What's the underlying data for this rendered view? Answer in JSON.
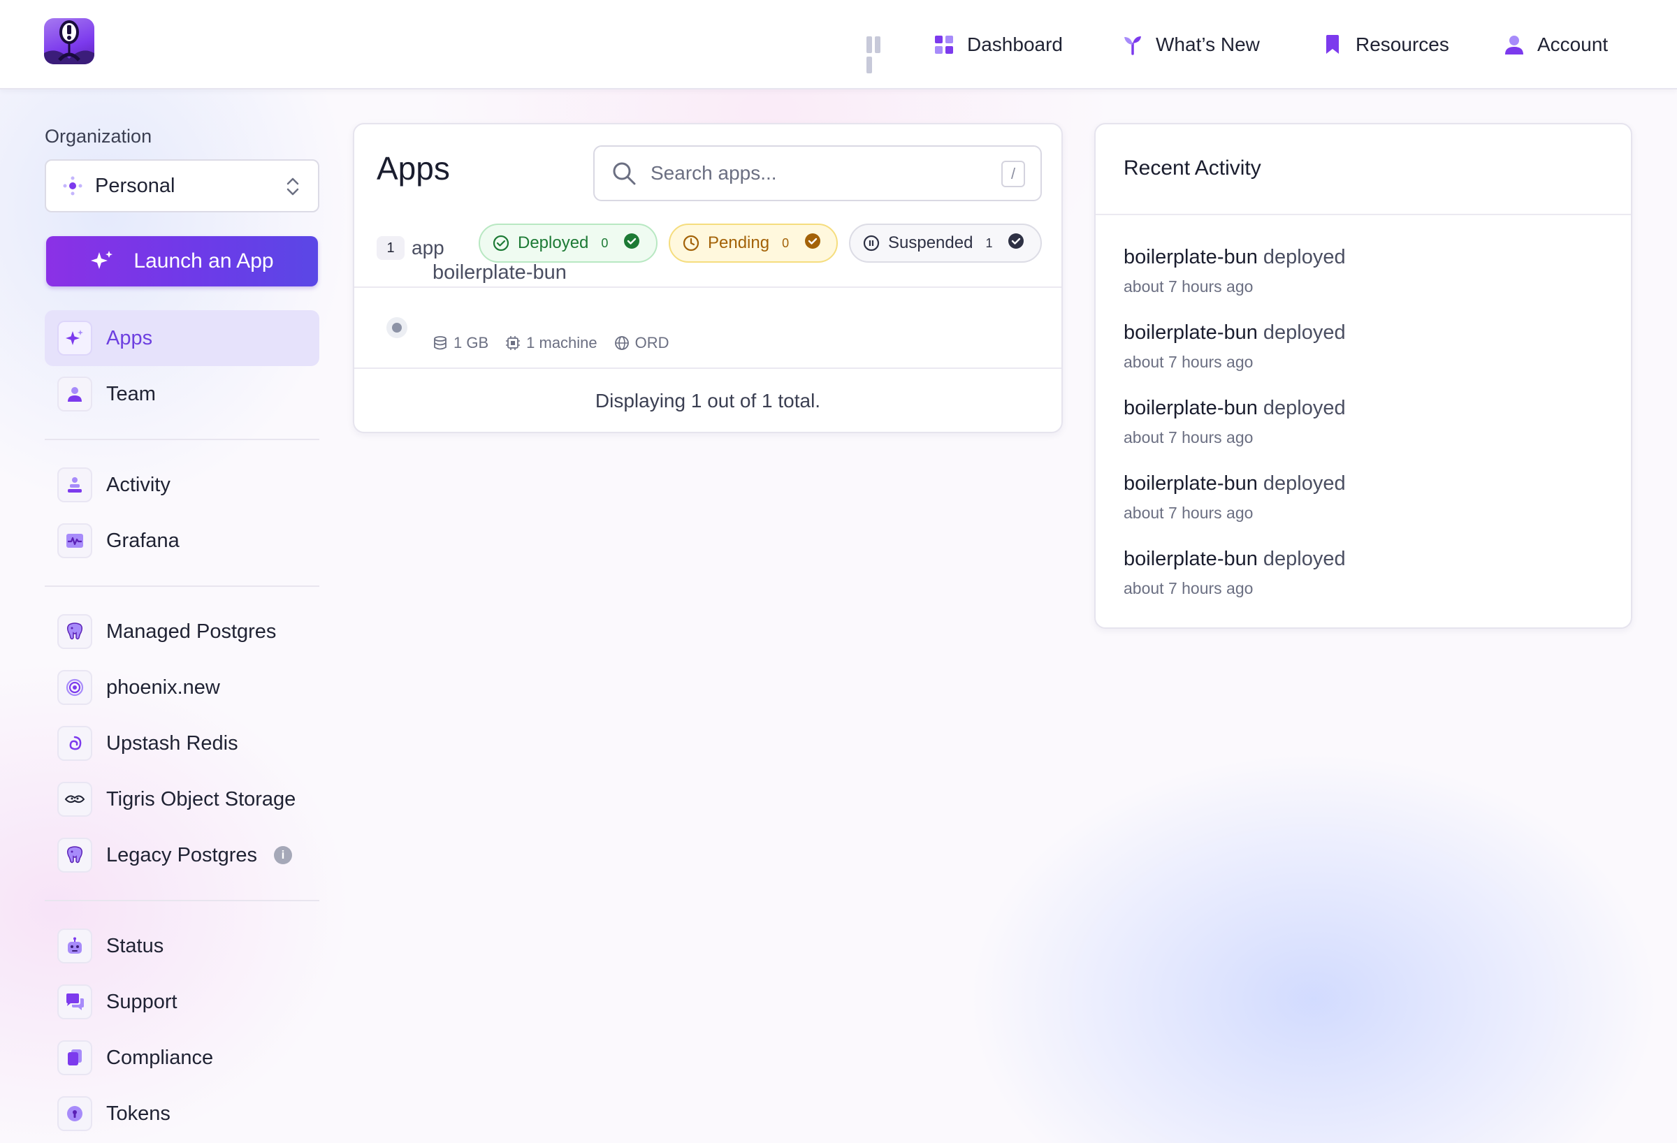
{
  "nav": {
    "dashboard": "Dashboard",
    "whats_new": "What’s New",
    "resources": "Resources",
    "account": "Account"
  },
  "sidebar": {
    "org_label": "Organization",
    "org_value": "Personal",
    "launch_label": "Launch an App",
    "groups": [
      [
        "Apps",
        "Team"
      ],
      [
        "Activity",
        "Grafana"
      ],
      [
        "Managed Postgres",
        "phoenix.new",
        "Upstash Redis",
        "Tigris Object Storage",
        "Legacy Postgres"
      ],
      [
        "Status",
        "Support",
        "Compliance",
        "Tokens"
      ]
    ],
    "items": {
      "apps": "Apps",
      "team": "Team",
      "activity": "Activity",
      "grafana": "Grafana",
      "managed_postgres": "Managed Postgres",
      "phoenix": "phoenix.new",
      "upstash": "Upstash Redis",
      "tigris": "Tigris Object Storage",
      "legacy_postgres": "Legacy Postgres",
      "status": "Status",
      "support": "Support",
      "compliance": "Compliance",
      "tokens": "Tokens"
    },
    "active": "Apps"
  },
  "apps": {
    "title": "Apps",
    "search_placeholder": "Search apps...",
    "search_shortcut": "/",
    "count": "1",
    "count_label": "app",
    "filters": {
      "deployed": {
        "label": "Deployed",
        "count": "0"
      },
      "pending": {
        "label": "Pending",
        "count": "0"
      },
      "suspended": {
        "label": "Suspended",
        "count": "1"
      }
    },
    "rows": [
      {
        "name": "boilerplate-bun",
        "memory": "1 GB",
        "machines": "1 machine",
        "region": "ORD"
      }
    ],
    "footer": "Displaying 1 out of 1 total."
  },
  "activity": {
    "title": "Recent Activity",
    "items": [
      {
        "app": "boilerplate-bun",
        "verb": "deployed",
        "time": "about 7 hours ago"
      },
      {
        "app": "boilerplate-bun",
        "verb": "deployed",
        "time": "about 7 hours ago"
      },
      {
        "app": "boilerplate-bun",
        "verb": "deployed",
        "time": "about 7 hours ago"
      },
      {
        "app": "boilerplate-bun",
        "verb": "deployed",
        "time": "about 7 hours ago"
      },
      {
        "app": "boilerplate-bun",
        "verb": "deployed",
        "time": "about 7 hours ago"
      }
    ]
  },
  "colors": {
    "accent": "#7c3aed",
    "deployed": "#1d7a35",
    "pending": "#a36208",
    "suspended": "#2e3144"
  }
}
